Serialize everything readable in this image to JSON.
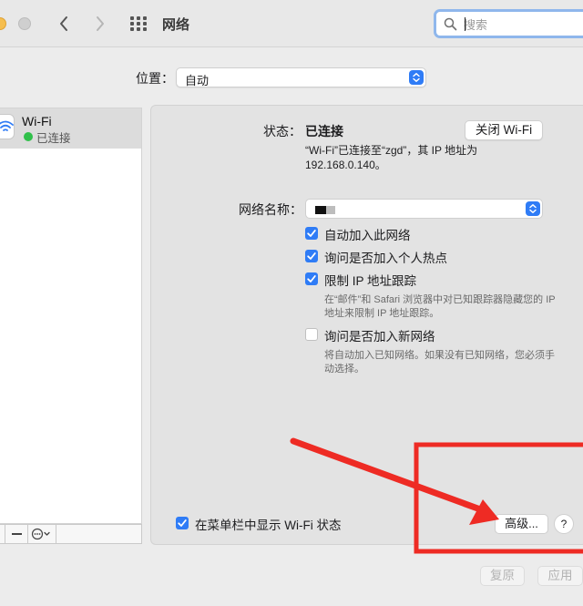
{
  "window": {
    "title": "网络",
    "search_placeholder": "搜索"
  },
  "location": {
    "label": "位置：",
    "value": "自动"
  },
  "sidebar": {
    "items": [
      {
        "name": "Wi-Fi",
        "status": "已连接",
        "status_color": "#30c04a"
      }
    ],
    "toolbar": {
      "remove_label": "—",
      "action_icon": "ellipsis-circle-icon"
    }
  },
  "main": {
    "status_label": "状态：",
    "status_value": "已连接",
    "wifi_off_button": "关闭 Wi-Fi",
    "status_description": "“Wi-Fi”已连接至“zgd”，其 IP 地址为 192.168.0.140。",
    "network_name_label": "网络名称：",
    "checkboxes": [
      {
        "label": "自动加入此网络",
        "checked": true
      },
      {
        "label": "询问是否加入个人热点",
        "checked": true
      },
      {
        "label": "限制 IP 地址跟踪",
        "checked": true,
        "description": "在“邮件”和 Safari 浏览器中对已知跟踪器隐藏您的 IP 地址来限制 IP 地址跟踪。"
      },
      {
        "label": "询问是否加入新网络",
        "checked": false,
        "description": "将自动加入已知网络。如果没有已知网络，您必须手动选择。"
      }
    ],
    "menubar_checkbox": {
      "label": "在菜单栏中显示 Wi-Fi 状态",
      "checked": true
    },
    "advanced_button": "高级...",
    "help_button": "?"
  },
  "footer": {
    "revert_button": "复原",
    "apply_button": "应用"
  },
  "colors": {
    "accent": "#2f7cf6",
    "annotation": "#ee2b24"
  }
}
